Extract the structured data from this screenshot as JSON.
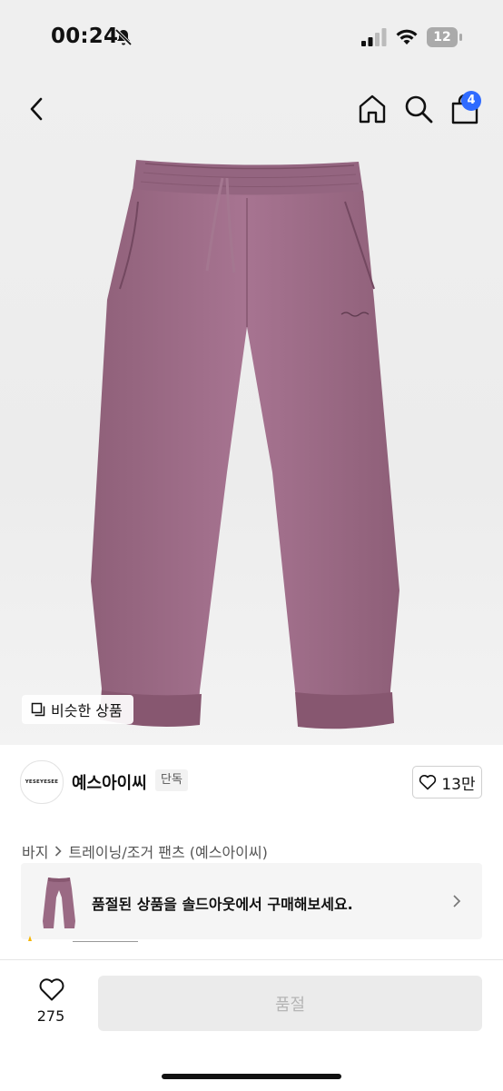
{
  "status_bar": {
    "time": "00:24",
    "battery": "12"
  },
  "header": {
    "cart_count": "4",
    "icons": [
      "back-icon",
      "home-icon",
      "search-icon",
      "bag-icon"
    ]
  },
  "product_image": {
    "similar_button_label": "비슷한 상품"
  },
  "brand": {
    "logo_text": "YESEYESEE",
    "name": "예스아이씨",
    "badge": "단독",
    "like_count": "13만"
  },
  "breadcrumb": {
    "category": "바지",
    "subcategory": "트레이닝/조거 팬츠 (예스아이씨)"
  },
  "soldout_banner": {
    "message": "품절된 상품을 솔드아웃에서 구매해보세요."
  },
  "bottom_bar": {
    "like_count": "275",
    "buy_label": "품절"
  },
  "colors": {
    "badge_blue": "#2f6bff",
    "pants_mauve": "#9a6a84",
    "disabled_button": "#ebebeb"
  }
}
